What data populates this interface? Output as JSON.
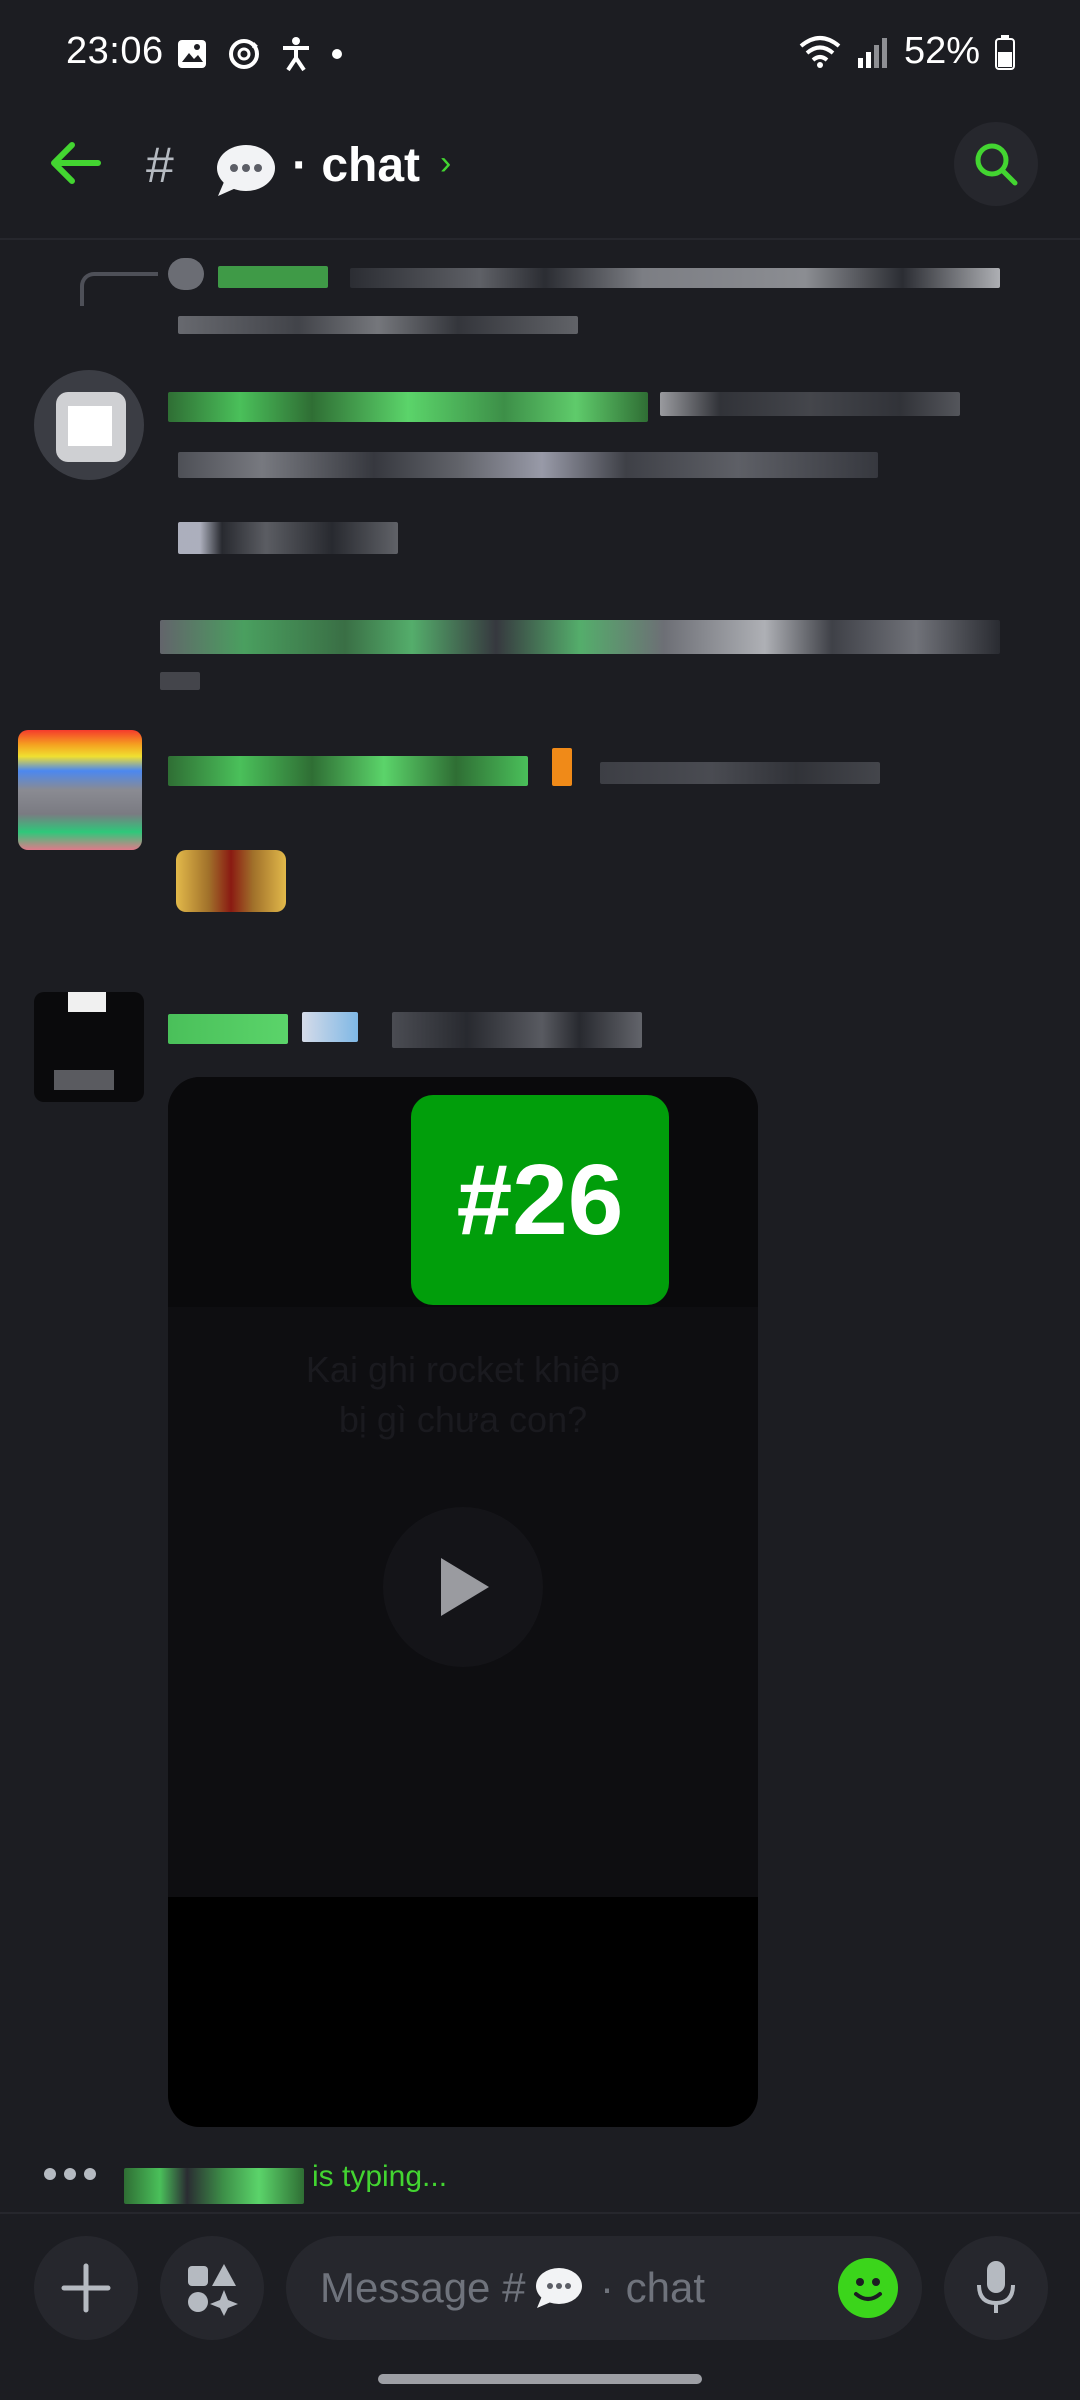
{
  "status_bar": {
    "time": "23:06",
    "battery": "52%",
    "icons": [
      "gallery-icon",
      "sync-icon",
      "accessibility-icon",
      "dot-icon",
      "wifi-icon",
      "signal-icon",
      "battery-icon"
    ]
  },
  "header": {
    "hash": "#",
    "channel_name": "· chat",
    "arrow": "›"
  },
  "video": {
    "badge": "#26",
    "caption_line1": "Kai ghi rocket khiêp",
    "caption_line2": "bị gì chưa con?"
  },
  "typing": {
    "text": "is typing..."
  },
  "composer": {
    "placeholder_prefix": "Message #",
    "placeholder_suffix": "· chat"
  },
  "colors": {
    "accent": "#43d531",
    "background": "#1c1d22",
    "surface": "#26272d",
    "badge": "#019e0b"
  }
}
